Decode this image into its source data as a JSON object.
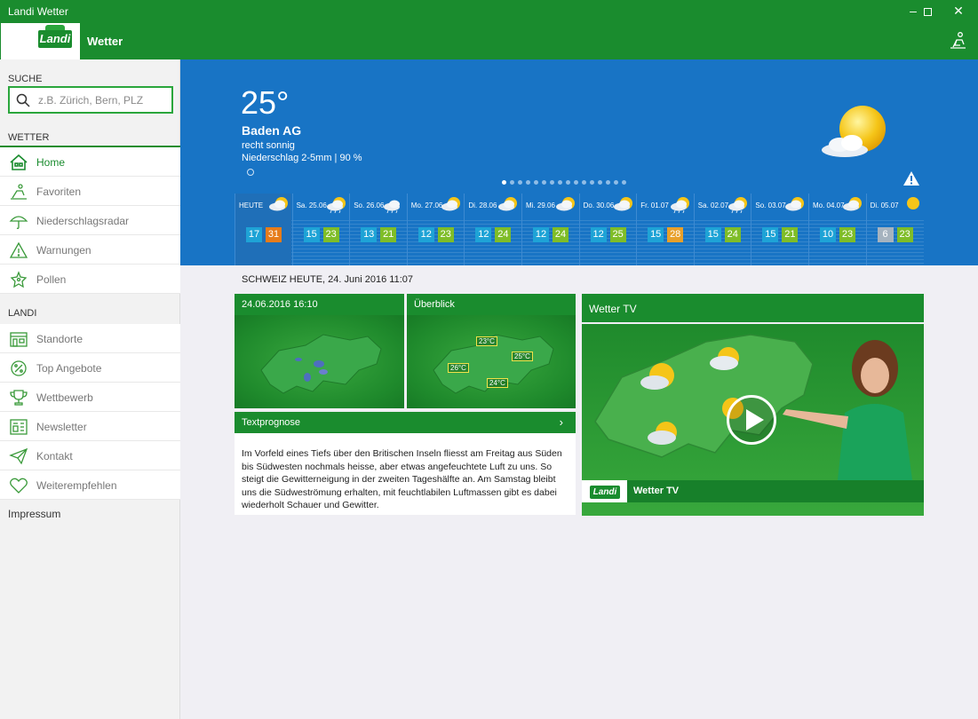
{
  "window": {
    "title": "Landi Wetter",
    "min_icon": "minimize-icon",
    "max_icon": "maximize-icon",
    "close_icon": "close-icon"
  },
  "header": {
    "logo_text": "Landi",
    "app_title": "Wetter",
    "user_icon": "person-chair-icon"
  },
  "sidebar": {
    "search_label": "SUCHE",
    "search_placeholder": "z.B. Zürich, Bern, PLZ",
    "wetter_label": "WETTER",
    "wetter_items": [
      {
        "label": "Home",
        "icon": "house-icon",
        "active": true
      },
      {
        "label": "Favoriten",
        "icon": "lounger-icon"
      },
      {
        "label": "Niederschlagsradar",
        "icon": "umbrella-icon"
      },
      {
        "label": "Warnungen",
        "icon": "warning-icon"
      },
      {
        "label": "Pollen",
        "icon": "pollen-icon"
      }
    ],
    "landi_label": "LANDI",
    "landi_items": [
      {
        "label": "Standorte",
        "icon": "store-icon"
      },
      {
        "label": "Top Angebote",
        "icon": "percent-icon"
      },
      {
        "label": "Wettbewerb",
        "icon": "trophy-icon"
      },
      {
        "label": "Newsletter",
        "icon": "newsletter-icon"
      },
      {
        "label": "Kontakt",
        "icon": "paper-plane-icon"
      },
      {
        "label": "Weiterempfehlen",
        "icon": "heart-icon"
      }
    ],
    "impressum": "Impressum"
  },
  "hero": {
    "temperature": "25°",
    "city": "Baden AG",
    "condition": "recht sonnig",
    "precipitation": "Niederschlag 2-5mm | 90 %",
    "weather_icon": "sun-cloud-icon",
    "alert_icon": "warning-icon",
    "page_dots": 16,
    "active_dot": 0
  },
  "forecast": [
    {
      "day": "HEUTE",
      "min": 17,
      "max": 31,
      "icon": "sun-cloud-icon",
      "max_style": "hot"
    },
    {
      "day": "Sa. 25.06",
      "min": 15,
      "max": 23,
      "icon": "sun-cloud-rain-icon"
    },
    {
      "day": "So. 26.06",
      "min": 13,
      "max": 21,
      "icon": "cloud-rain-icon"
    },
    {
      "day": "Mo. 27.06",
      "min": 12,
      "max": 23,
      "icon": "sun-cloud-icon"
    },
    {
      "day": "Di. 28.06",
      "min": 12,
      "max": 24,
      "icon": "sun-cloud-icon"
    },
    {
      "day": "Mi. 29.06",
      "min": 12,
      "max": 24,
      "icon": "sun-cloud-icon"
    },
    {
      "day": "Do. 30.06",
      "min": 12,
      "max": 25,
      "icon": "sun-cloud-icon"
    },
    {
      "day": "Fr. 01.07",
      "min": 15,
      "max": 28,
      "icon": "sun-cloud-rain-icon",
      "max_style": "warm"
    },
    {
      "day": "Sa. 02.07",
      "min": 15,
      "max": 24,
      "icon": "sun-cloud-rain-icon"
    },
    {
      "day": "So. 03.07",
      "min": 15,
      "max": 21,
      "icon": "sun-cloud-icon"
    },
    {
      "day": "Mo. 04.07",
      "min": 10,
      "max": 23,
      "icon": "sun-cloud-icon"
    },
    {
      "day": "Di. 05.07",
      "min": 6,
      "max": 23,
      "icon": "sun-icon",
      "min_style": "gray"
    }
  ],
  "main": {
    "section_title": "SCHWEIZ HEUTE, 24. Juni 2016 11:07",
    "radar_card_title": "24.06.2016 16:10",
    "overview_card_title": "Überblick",
    "overview_tags": [
      "23°C",
      "25°C",
      "26°C",
      "24°C"
    ],
    "text_card_title": "Textprognose",
    "text_card_body": "Im Vorfeld eines Tiefs über den Britischen Inseln fliesst am Freitag aus Süden bis Südwesten nochmals heisse, aber etwas angefeuchtete Luft zu uns. So steigt die Gewitterneigung in der zweiten Tageshälfte an. Am Samstag bleibt uns die Südweströmung erhalten, mit feuchtlabilen Luftmassen gibt es dabei wiederholt Schauer und Gewitter.",
    "tv_card_title": "Wetter TV",
    "tv_bar_label": "Wetter TV",
    "tv_logo": "Landi"
  },
  "colors": {
    "brand_green": "#1a8c2e",
    "hero_blue": "#1874c5",
    "min_temp": "#1ea3d6",
    "max_temp": "#7fbd28",
    "hot_temp": "#e67c1a"
  }
}
